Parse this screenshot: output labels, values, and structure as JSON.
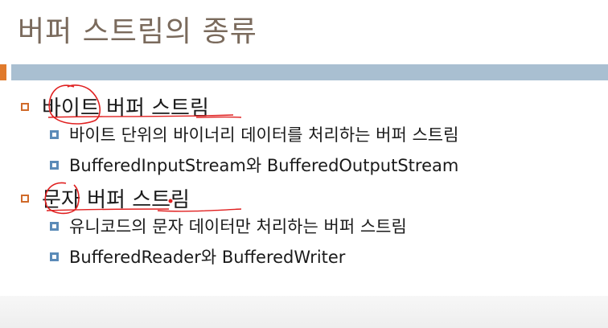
{
  "slide": {
    "title": "버퍼 스트림의 종류",
    "items": [
      {
        "text": "바이트 버퍼 스트림",
        "sub": [
          "바이트 단위의 바이너리 데이터를 처리하는 버퍼 스트림",
          "BufferedInputStream와 BufferedOutputStream"
        ]
      },
      {
        "text": "문자 버퍼 스트림",
        "sub": [
          "유니코드의 문자 데이터만 처리하는 버퍼 스트림",
          "BufferedReader와 BufferedWriter"
        ]
      }
    ]
  },
  "colors": {
    "title": "#7a6a5c",
    "header_bar": "#a9bfd1",
    "accent": "#e07a2c",
    "bullet_level1": "#d06a2a",
    "bullet_level2": "#5b8bb8",
    "annotation": "#e02020"
  }
}
